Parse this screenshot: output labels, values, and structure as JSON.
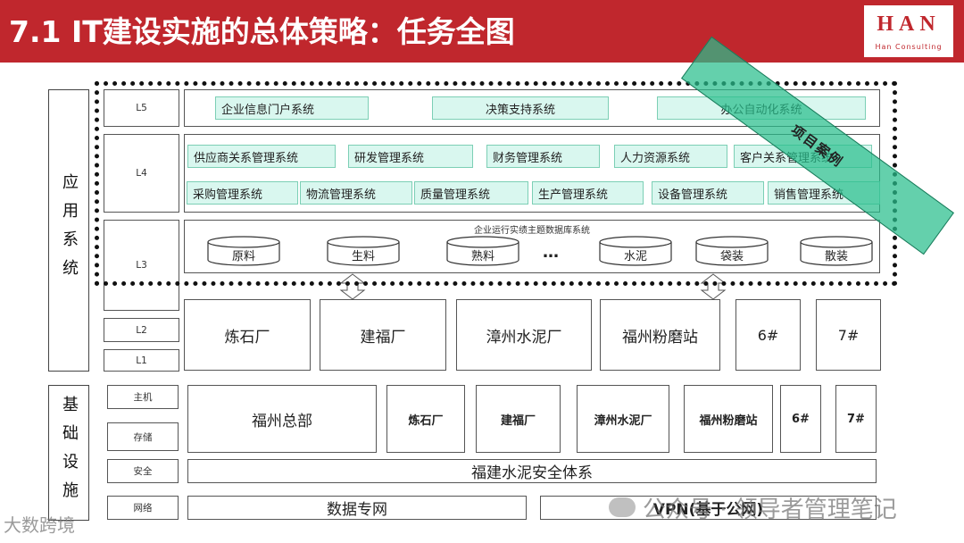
{
  "header": {
    "title": "7.1 IT建设实施的总体策略：任务全图",
    "logo": "HAN",
    "logo_sub": "Han Consulting"
  },
  "application": {
    "section_label": "应用系统",
    "levels": {
      "l5": "L5",
      "l4": "L4",
      "l3": "L3",
      "l2": "L2",
      "l1": "L1"
    },
    "l5_systems": [
      "企业信息门户系统",
      "决策支持系统",
      "办公自动化系统"
    ],
    "l4_row1": [
      "供应商关系管理系统",
      "研发管理系统",
      "财务管理系统",
      "人力资源系统",
      "客户关系管理系统"
    ],
    "l4_row2": [
      "采购管理系统",
      "物流管理系统",
      "质量管理系统",
      "生产管理系统",
      "设备管理系统",
      "销售管理系统"
    ],
    "l3_title": "企业运行实绩主题数据库系统",
    "l3_databases": [
      "原料",
      "生料",
      "熟料",
      "水泥",
      "袋装",
      "散装"
    ],
    "l3_ellipsis": "…",
    "plants": [
      "炼石厂",
      "建福厂",
      "漳州水泥厂",
      "福州粉磨站",
      "6#",
      "7#"
    ]
  },
  "project_banner": "项目案例",
  "infrastructure": {
    "section_label": "基础设施",
    "rows": {
      "host": "主机",
      "storage": "存储",
      "security": "安全",
      "network": "网络"
    },
    "hq": "福州总部",
    "sites": [
      "炼石厂",
      "建福厂",
      "漳州水泥厂",
      "福州粉磨站",
      "6#",
      "7#"
    ],
    "security_system": "福建水泥安全体系",
    "network_private": "数据专网",
    "network_vpn": "VPN(基于公网)"
  },
  "watermarks": {
    "right": "公众号 · 领导者管理笔记",
    "left": "大数跨境"
  },
  "colors": {
    "header_red": "#c0272d",
    "system_fill": "#d9f7ef",
    "banner_green": "#28be8c"
  }
}
